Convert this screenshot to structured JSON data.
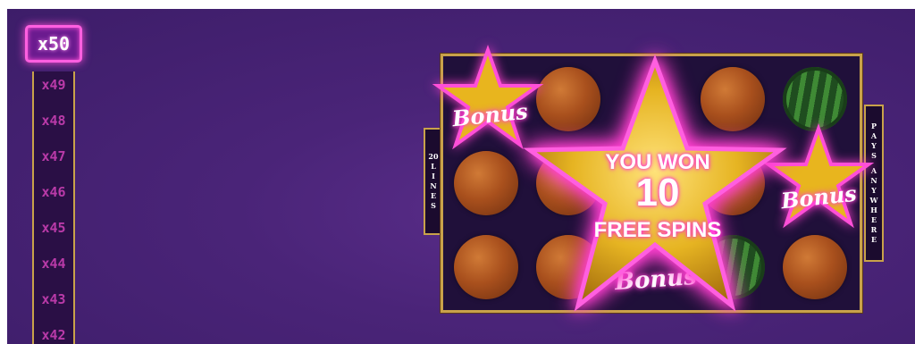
{
  "header": {
    "title_fragment": ""
  },
  "multiplier": {
    "active": "x50",
    "ladder": [
      "x49",
      "x48",
      "x47",
      "x46",
      "x45",
      "x44",
      "x43",
      "x42"
    ]
  },
  "reels": {
    "grid": [
      [
        "bonus-star",
        "orange",
        "bonus-star",
        "orange",
        "watermelon"
      ],
      [
        "orange",
        "orange",
        "bonus-star",
        "orange",
        "bonus-star"
      ],
      [
        "orange",
        "orange",
        "bonus-star",
        "watermelon",
        "orange"
      ]
    ],
    "lines_label": [
      "20",
      "L",
      "I",
      "N",
      "E",
      "S"
    ],
    "pays_label": [
      "P",
      "A",
      "Y",
      "S",
      "",
      "A",
      "N",
      "Y",
      "W",
      "H",
      "E",
      "R",
      "E"
    ]
  },
  "win_popup": {
    "line1": "YOU WON",
    "amount": "10",
    "line3": "FREE SPINS"
  },
  "bonus_symbol": {
    "label": "Bonus"
  },
  "colors": {
    "background": "#3d1d69",
    "neon_pink": "#ff3fd0",
    "gold": "#e6b422",
    "frame_gold": "#c9a24a"
  }
}
